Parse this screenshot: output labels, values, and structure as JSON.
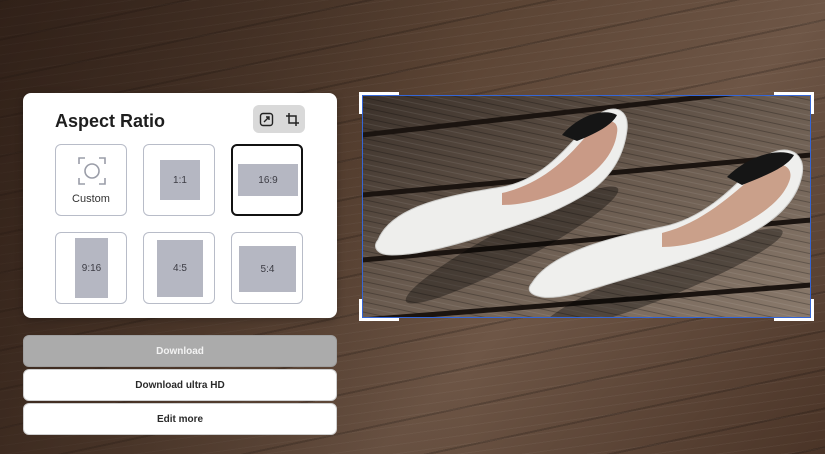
{
  "panel": {
    "title": "Aspect Ratio",
    "tools": [
      {
        "icon": "resize-icon"
      },
      {
        "icon": "crop-icon"
      }
    ],
    "ratios": [
      {
        "label": "Custom",
        "selected": false
      },
      {
        "label": "1:1",
        "selected": false
      },
      {
        "label": "16:9",
        "selected": true
      },
      {
        "label": "9:16",
        "selected": false
      },
      {
        "label": "4:5",
        "selected": false
      },
      {
        "label": "5:4",
        "selected": false
      }
    ]
  },
  "buttons": {
    "download": "Download",
    "download_uhd": "Download ultra HD",
    "edit_more": "Edit more"
  },
  "colors": {
    "crop_frame": "#3466d6",
    "selected_border": "#111111",
    "ratio_fill": "#b5b7c2"
  }
}
